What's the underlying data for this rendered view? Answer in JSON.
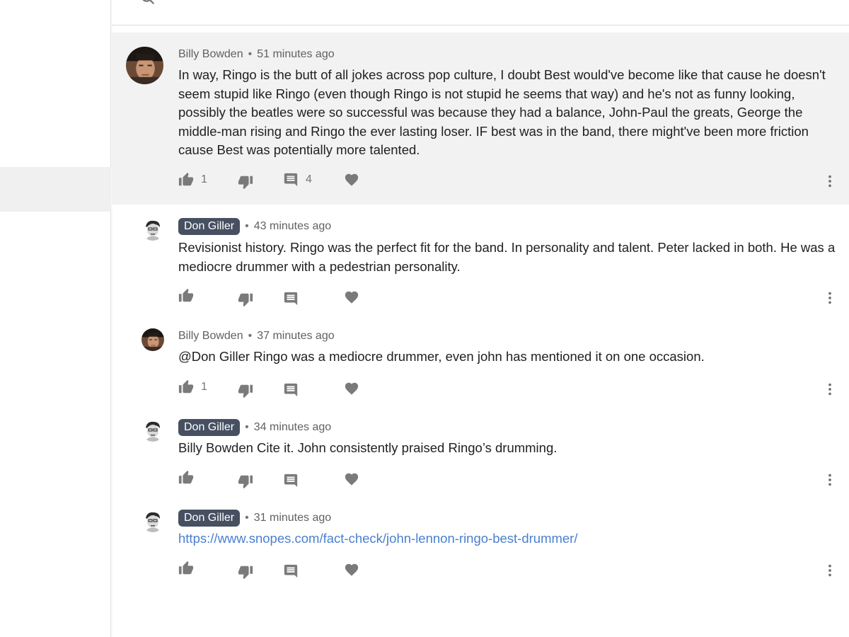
{
  "app": {
    "colors": {
      "accent_link": "#4a7fd1",
      "badge_bg": "#475061",
      "highlight_bg": "#f2f2f2"
    }
  },
  "comments": [
    {
      "author": "Billy Bowden",
      "time": "51 minutes ago",
      "text": "In way, Ringo is the butt of all jokes across pop culture, I doubt Best would've become like that cause he doesn't seem stupid like Ringo (even though Ringo is not stupid he seems that way) and he's not as funny looking, possibly the beatles were so successful was because they had a balance, John-Paul the greats, George the middle-man rising and Ringo the ever lasting loser. IF best was in the band, there might've been more friction cause Best was potentially more talented.",
      "likes": "1",
      "replies": "4"
    },
    {
      "author": "Don Giller",
      "time": "43 minutes ago",
      "text": "Revisionist history. Ringo was the perfect fit for the band. In personality and talent. Peter lacked in both. He was a mediocre drummer with a pedestrian personality."
    },
    {
      "author": "Billy Bowden",
      "time": "37 minutes ago",
      "text": "@Don Giller Ringo was a mediocre drummer, even john has mentioned it on one occasion.",
      "likes": "1"
    },
    {
      "author": "Don Giller",
      "time": "34 minutes ago",
      "text": "Billy Bowden Cite it. John consistently praised Ringo’s drumming."
    },
    {
      "author": "Don Giller",
      "time": "31 minutes ago",
      "link": "https://www.snopes.com/fact-check/john-lennon-ringo-best-drummer/"
    }
  ],
  "icons": {
    "like": "thumb-up-icon",
    "dislike": "thumb-down-icon",
    "reply": "comment-icon",
    "favorite": "heart-icon",
    "more": "more-vert-icon",
    "search": "search-icon"
  }
}
